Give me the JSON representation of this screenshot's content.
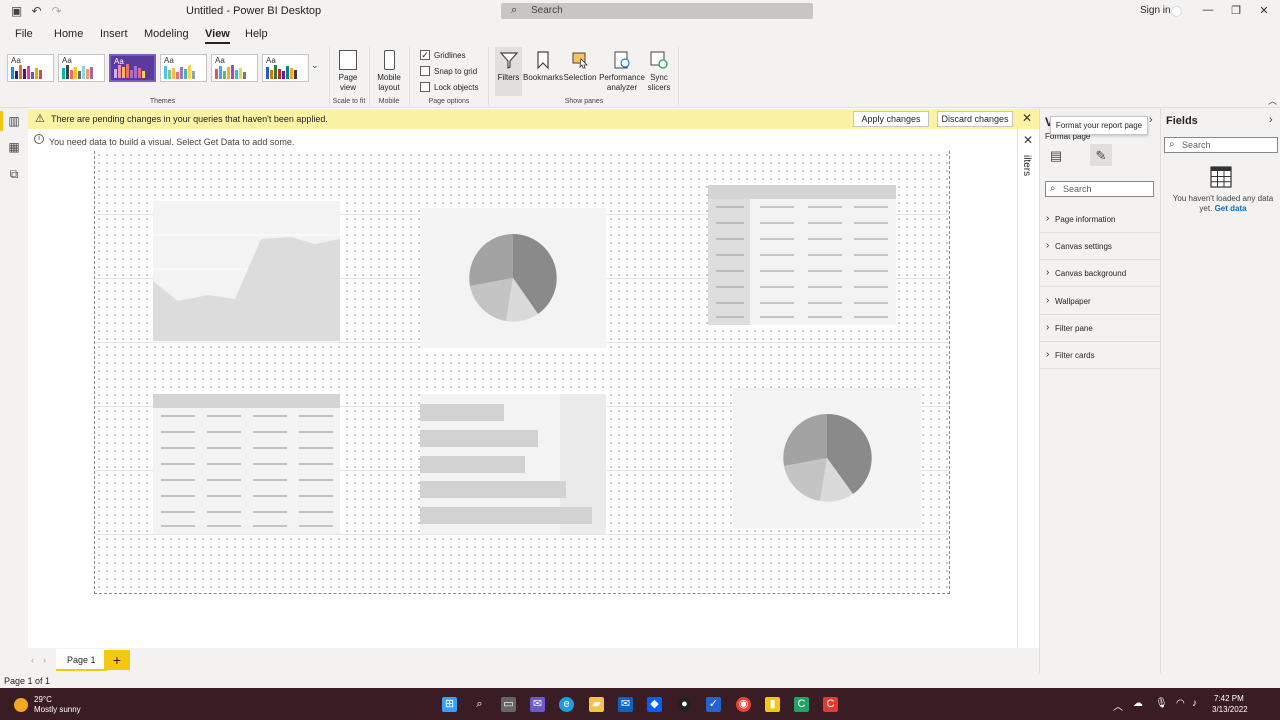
{
  "window": {
    "title": "Untitled - Power BI Desktop",
    "search_placeholder": "Search",
    "sign_in": "Sign in"
  },
  "menu": {
    "tabs": [
      "File",
      "Home",
      "Insert",
      "Modeling",
      "View",
      "Help"
    ],
    "active": "View"
  },
  "ribbon": {
    "groups": {
      "themes": "Themes",
      "scale_to_fit": "Scale to fit",
      "mobile": "Mobile",
      "page_options": "Page options",
      "show_panes": "Show panes"
    },
    "theme_label": "Aa",
    "page_view": "Page view",
    "mobile_layout": "Mobile layout",
    "gridlines": {
      "label": "Gridlines",
      "checked": true
    },
    "snap_to_grid": {
      "label": "Snap to grid",
      "checked": false
    },
    "lock_objects": {
      "label": "Lock objects",
      "checked": false
    },
    "panes": [
      "Filters",
      "Bookmarks",
      "Selection",
      "Performance analyzer",
      "Sync slicers"
    ]
  },
  "notifications": {
    "pending": "There are pending changes in your queries that haven't been applied.",
    "apply": "Apply changes",
    "discard": "Discard changes",
    "info": "You need data to build a visual. Select Get Data to add some."
  },
  "filters_pane": {
    "label": "ilters"
  },
  "visualizations": {
    "title": "V",
    "tooltip": "Format your report page",
    "format_label": "Format page",
    "search_placeholder": "Search",
    "sections": [
      "Page information",
      "Canvas settings",
      "Canvas background",
      "Wallpaper",
      "Filter pane",
      "Filter cards"
    ]
  },
  "fields": {
    "title": "Fields",
    "search_placeholder": "Search",
    "empty_message": "You haven't loaded any data yet.",
    "get_data": "Get data"
  },
  "pages": {
    "tabs": [
      "Page 1"
    ],
    "status": "Page 1 of 1"
  },
  "taskbar": {
    "temperature": "29°C",
    "condition": "Mostly sunny",
    "time": "7:42 PM",
    "date": "3/13/2022"
  },
  "colors": {
    "accent": "#f2c811",
    "warning_bg": "#fbf3a3",
    "taskbar_bg": "#3a1c24",
    "link": "#0f6cbd"
  }
}
